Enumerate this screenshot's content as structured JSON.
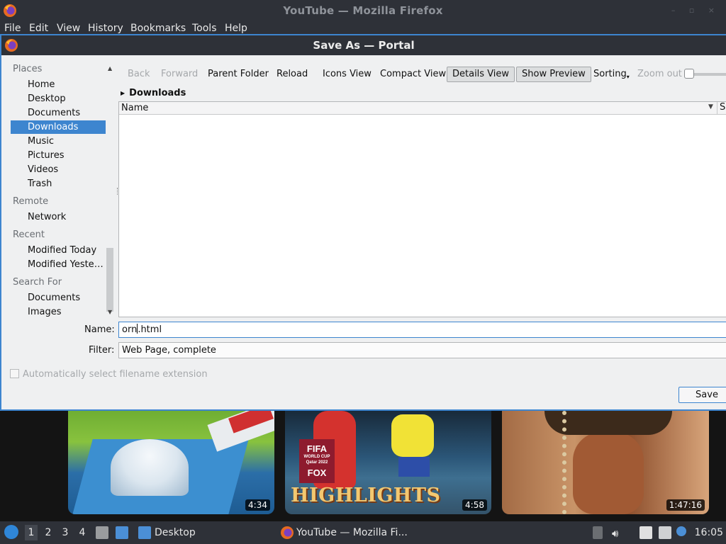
{
  "browser": {
    "window_title": "YouTube — Mozilla Firefox",
    "menu": [
      "File",
      "Edit",
      "View",
      "History",
      "Bookmarks",
      "Tools",
      "Help"
    ],
    "videos": [
      {
        "duration": "4:34"
      },
      {
        "duration": "4:58",
        "badge_line1": "FIFA",
        "badge_line2": "WORLD CUP",
        "badge_line3": "Qatar 2022",
        "badge_network": "FOX",
        "overlay_text": "HIGHLIGHTS"
      },
      {
        "duration": "1:47:16"
      }
    ]
  },
  "dialog": {
    "title": "Save As — Portal",
    "places": {
      "sections": [
        {
          "heading": "Places",
          "items": [
            "Home",
            "Desktop",
            "Documents",
            "Downloads",
            "Music",
            "Pictures",
            "Videos",
            "Trash"
          ]
        },
        {
          "heading": "Remote",
          "items": [
            "Network"
          ]
        },
        {
          "heading": "Recent",
          "items": [
            "Modified Today",
            "Modified Yester…"
          ]
        },
        {
          "heading": "Search For",
          "items": [
            "Documents",
            "Images"
          ]
        }
      ],
      "selected": "Downloads"
    },
    "toolbar": {
      "back": "Back",
      "forward": "Forward",
      "parent_folder": "Parent Folder",
      "reload": "Reload",
      "icons_view": "Icons View",
      "compact_view": "Compact View",
      "details_view": "Details View",
      "show_preview": "Show Preview",
      "sorting": "Sorting",
      "zoom_out": "Zoom out"
    },
    "breadcrumb": "Downloads",
    "columns": {
      "name": "Name",
      "size": "Si"
    },
    "name_label": "Name:",
    "name_value_before_caret": "orn",
    "name_value_after_caret": ".html",
    "filter_label": "Filter:",
    "filter_value": "Web Page, complete",
    "auto_extension_label": "Automatically select filename extension",
    "save_button": "Save"
  },
  "taskbar": {
    "workspaces": [
      "1",
      "2",
      "3",
      "4"
    ],
    "active_workspace": "1",
    "desktop_label": "Desktop",
    "task_label": "YouTube — Mozilla Fi...",
    "clock": "16:05"
  },
  "colors": {
    "accent": "#3d85cf",
    "titlebar": "#2e3138",
    "dialog_bg": "#eff0f1"
  }
}
